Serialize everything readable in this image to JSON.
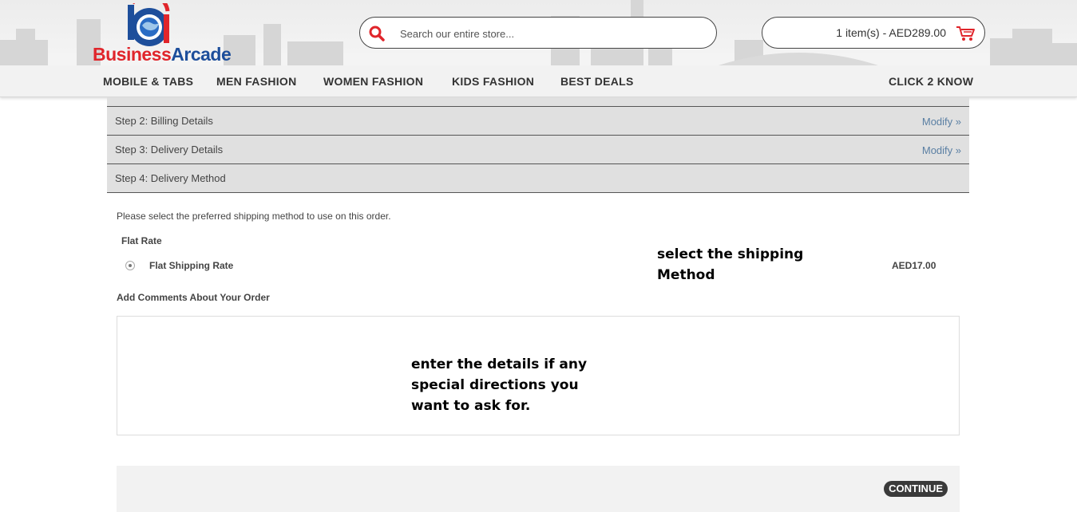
{
  "brand": {
    "part1": "Business",
    "part2": "Arcade",
    "red": "#e0252b",
    "blue": "#1d4e9b"
  },
  "search": {
    "placeholder": "Search our entire store...",
    "icon": "search-icon"
  },
  "cart": {
    "summary": "1 item(s) - AED289.00",
    "icon": "cart-icon"
  },
  "nav": {
    "items": [
      "MOBILE & TABS",
      "MEN FASHION",
      "WOMEN FASHION",
      "KIDS FASHION",
      "BEST DEALS"
    ],
    "right": "CLICK 2 KNOW"
  },
  "steps": [
    {
      "label": "Step 2: Billing Details",
      "modify": "Modify »"
    },
    {
      "label": "Step 3: Delivery Details",
      "modify": "Modify »"
    },
    {
      "label": "Step 4: Delivery Method"
    }
  ],
  "delivery": {
    "intro": "Please select the preferred shipping method to use on this order.",
    "group_title": "Flat Rate",
    "option_label": "Flat Shipping Rate",
    "option_price": "AED17.00",
    "comments_title": "Add Comments About Your Order"
  },
  "annotations": {
    "shipping": "select the shipping Method",
    "comments": "enter the details if any special directions you want to ask for."
  },
  "continue_label": "CONTINUE",
  "colors": {
    "link": "#5a7fa3",
    "step_bg": "#e0e0e0",
    "button": "#3a3a3a"
  }
}
